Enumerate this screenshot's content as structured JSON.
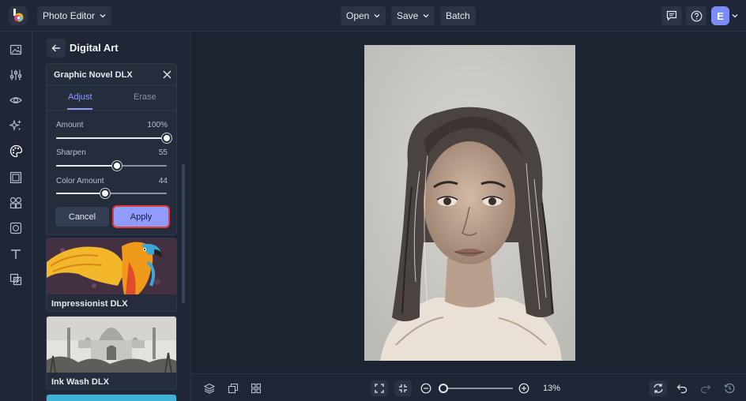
{
  "header": {
    "app_menu_label": "Photo Editor",
    "open_label": "Open",
    "save_label": "Save",
    "batch_label": "Batch",
    "avatar_initial": "E",
    "accent_color": "#8f9cfb"
  },
  "rail": {
    "icons": [
      "image-icon",
      "sliders-icon",
      "eye-icon",
      "sparkle-icon",
      "palette-icon",
      "frame-icon",
      "shapes-icon",
      "texture-icon",
      "text-icon",
      "layers-overlay-icon"
    ],
    "active_index": 4
  },
  "panel": {
    "title": "Digital Art",
    "effect": {
      "title": "Graphic Novel DLX",
      "tabs": [
        {
          "label": "Adjust",
          "active": true
        },
        {
          "label": "Erase",
          "active": false
        }
      ],
      "sliders": [
        {
          "label": "Amount",
          "value_text": "100%",
          "value": 100
        },
        {
          "label": "Sharpen",
          "value_text": "55",
          "value": 55
        },
        {
          "label": "Color Amount",
          "value_text": "44",
          "value": 44
        }
      ],
      "cancel_label": "Cancel",
      "apply_label": "Apply"
    },
    "presets": [
      {
        "label": "Impressionist DLX"
      },
      {
        "label": "Ink Wash DLX"
      }
    ]
  },
  "canvas": {
    "zoom_text": "13%",
    "zoom_value": 13
  }
}
